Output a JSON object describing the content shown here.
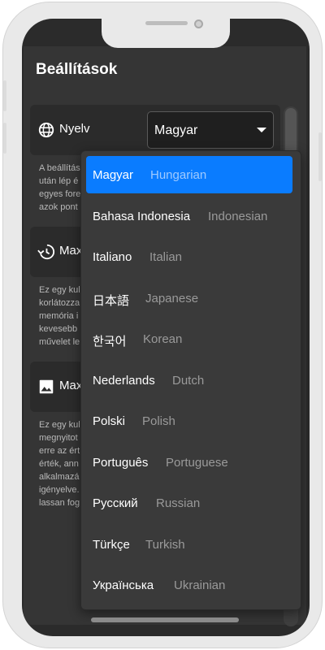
{
  "header": {
    "title": "Beállítások"
  },
  "language_setting": {
    "label": "Nyelv",
    "selected_value": "Magyar",
    "description": [
      "A beállítás",
      "után lép é",
      "egyes fore",
      "azok pont"
    ]
  },
  "history_setting": {
    "label": "Max",
    "description": [
      "Ez egy kul",
      "korlátozza",
      "memória i",
      "kevesebb",
      "művelet le"
    ]
  },
  "image_setting": {
    "label": "Max",
    "description": [
      "Ez egy kul",
      "megnyitot",
      "erre az ért",
      "érték, ann",
      "alkalmazá",
      "igényelve.",
      "lassan fog"
    ]
  },
  "dropdown": {
    "options": [
      {
        "native": "Magyar",
        "english": "Hungarian",
        "selected": true
      },
      {
        "native": "Bahasa Indonesia",
        "english": "Indonesian"
      },
      {
        "native": "Italiano",
        "english": "Italian"
      },
      {
        "native": "日本語",
        "english": "Japanese"
      },
      {
        "native": "한국어",
        "english": "Korean"
      },
      {
        "native": "Nederlands",
        "english": "Dutch"
      },
      {
        "native": "Polski",
        "english": "Polish"
      },
      {
        "native": "Português",
        "english": "Portuguese"
      },
      {
        "native": "Русский",
        "english": "Russian"
      },
      {
        "native": "Türkçe",
        "english": "Turkish"
      },
      {
        "native": "Українська",
        "english": "Ukrainian"
      }
    ]
  },
  "colors": {
    "accent": "#0a7cff",
    "background": "#353535",
    "card": "#2b2b2b"
  },
  "icons": {
    "language": "globe-icon",
    "history": "history-icon",
    "image": "image-icon",
    "caret": "caret-down-icon"
  }
}
